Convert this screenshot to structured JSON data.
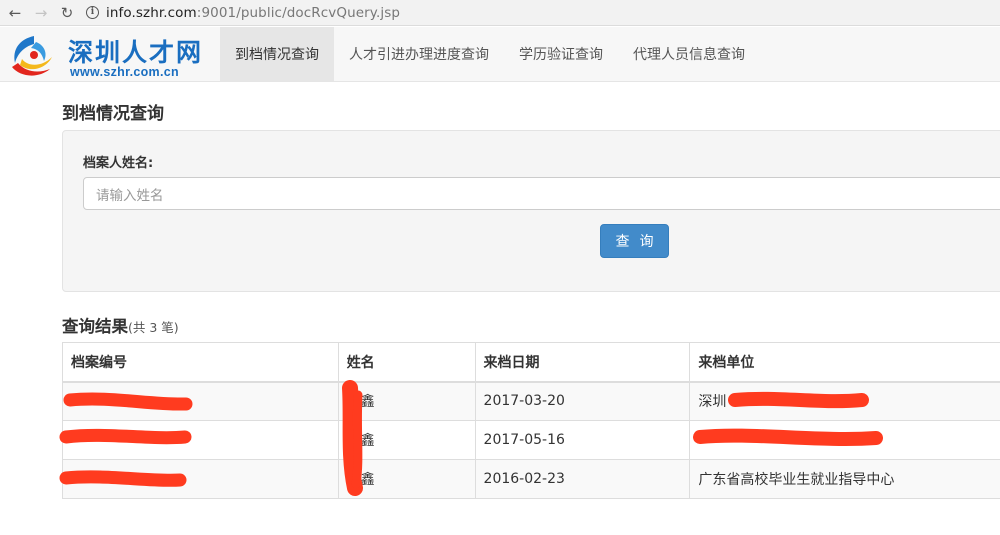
{
  "browser": {
    "url_host": "info.szhr.com",
    "url_rest": ":9001/public/docRcvQuery.jsp",
    "back_glyph": "←",
    "forward_glyph": "→",
    "reload_glyph": "↻",
    "info_glyph": "i"
  },
  "site": {
    "logo_title": "深圳人才网",
    "logo_url": "www.szhr.com.cn",
    "nav": [
      {
        "label": "到档情况查询",
        "active": true
      },
      {
        "label": "人才引进办理进度查询",
        "active": false
      },
      {
        "label": "学历验证查询",
        "active": false
      },
      {
        "label": "代理人员信息查询",
        "active": false
      }
    ]
  },
  "page": {
    "heading": "到档情况查询",
    "form": {
      "name_label": "档案人姓名:",
      "name_placeholder": "请输入姓名",
      "name_value": "",
      "submit_label": "查询"
    },
    "results": {
      "heading": "查询结果",
      "count_text": "(共 3 笔)",
      "columns": [
        "档案编号",
        "姓名",
        "来档日期",
        "来档单位"
      ],
      "rows": [
        {
          "id": "",
          "name": "培鑫",
          "date": "2017-03-20",
          "unit": "深圳"
        },
        {
          "id": "",
          "name": "培鑫",
          "date": "2017-05-16",
          "unit": ""
        },
        {
          "id": "",
          "name": "培鑫",
          "date": "2016-02-23",
          "unit": "广东省高校毕业生就业指导中心"
        }
      ]
    }
  },
  "colors": {
    "accent": "#428bca",
    "brand": "#1a6ec0",
    "redaction": "#ff3b1f"
  }
}
